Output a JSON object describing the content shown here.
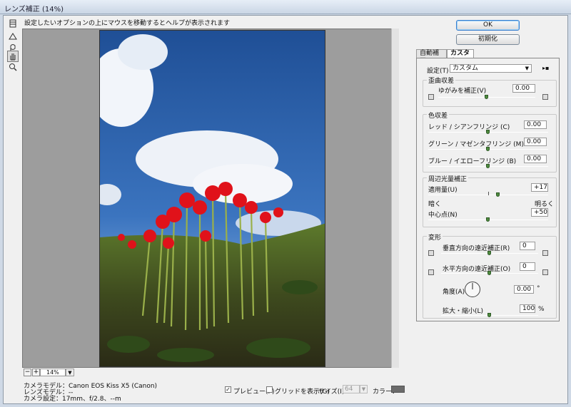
{
  "window": {
    "title": "レンズ補正 (14%)"
  },
  "help_text": "設定したいオプションの上にマウスを移動するとヘルプが表示されます",
  "zoom": {
    "minus": "−",
    "plus": "+",
    "value": "14%"
  },
  "camera_info": {
    "model": "カメラモデル：Canon EOS Kiss X5 (Canon)",
    "lens": "レンズモデル：--",
    "settings": "カメラ設定：17mm、f/2.8、--m"
  },
  "bottom": {
    "preview_label": "プレビュー(P)",
    "preview_checked": "✓",
    "grid_label": "グリッドを表示(G)",
    "size_label": "サイズ(I)：",
    "size_value": "64",
    "color_label": "カラー：",
    "grid_color": "#6b6b6b"
  },
  "buttons": {
    "ok": "OK",
    "reset": "初期化"
  },
  "tabs": [
    {
      "label": "自動補正"
    },
    {
      "label": "カスタム"
    }
  ],
  "settings": {
    "label": "設定(T)：",
    "value": "カスタム"
  },
  "distortion": {
    "title": "歪曲収差",
    "label": "ゆがみを補正(V)",
    "value": "0.00",
    "fraction": 0.5
  },
  "chromatic": {
    "title": "色収差",
    "items": [
      {
        "label": "レッド / シアンフリンジ (C)",
        "value": "0.00",
        "fraction": 0.5
      },
      {
        "label": "グリーン / マゼンタフリンジ (M)",
        "value": "0.00",
        "fraction": 0.5
      },
      {
        "label": "ブルー / イエローフリンジ (B)",
        "value": "0.00",
        "fraction": 0.5
      }
    ]
  },
  "vignette": {
    "title": "周辺光量補正",
    "amount_label": "適用量(U)",
    "amount_value": "+17",
    "amount_fraction": 0.585,
    "dark_label": "暗く",
    "light_label": "明るく",
    "mid_label": "中心点(N)",
    "mid_value": "+50",
    "mid_fraction": 0.5
  },
  "transform": {
    "title": "変形",
    "vertical_label": "垂直方向の遠近補正(R)",
    "vertical_value": "0",
    "vertical_fraction": 0.5,
    "horizontal_label": "水平方向の遠近補正(O)",
    "horizontal_value": "0",
    "horizontal_fraction": 0.5,
    "angle_label": "角度(A)：",
    "angle_value": "0.00",
    "angle_unit": "°",
    "scale_label": "拡大・縮小(L)",
    "scale_value": "100",
    "scale_unit": "%",
    "scale_fraction": 0.5
  },
  "colors": {
    "accent": "#3a7fcf",
    "slider_thumb": "#4f8a3f"
  }
}
